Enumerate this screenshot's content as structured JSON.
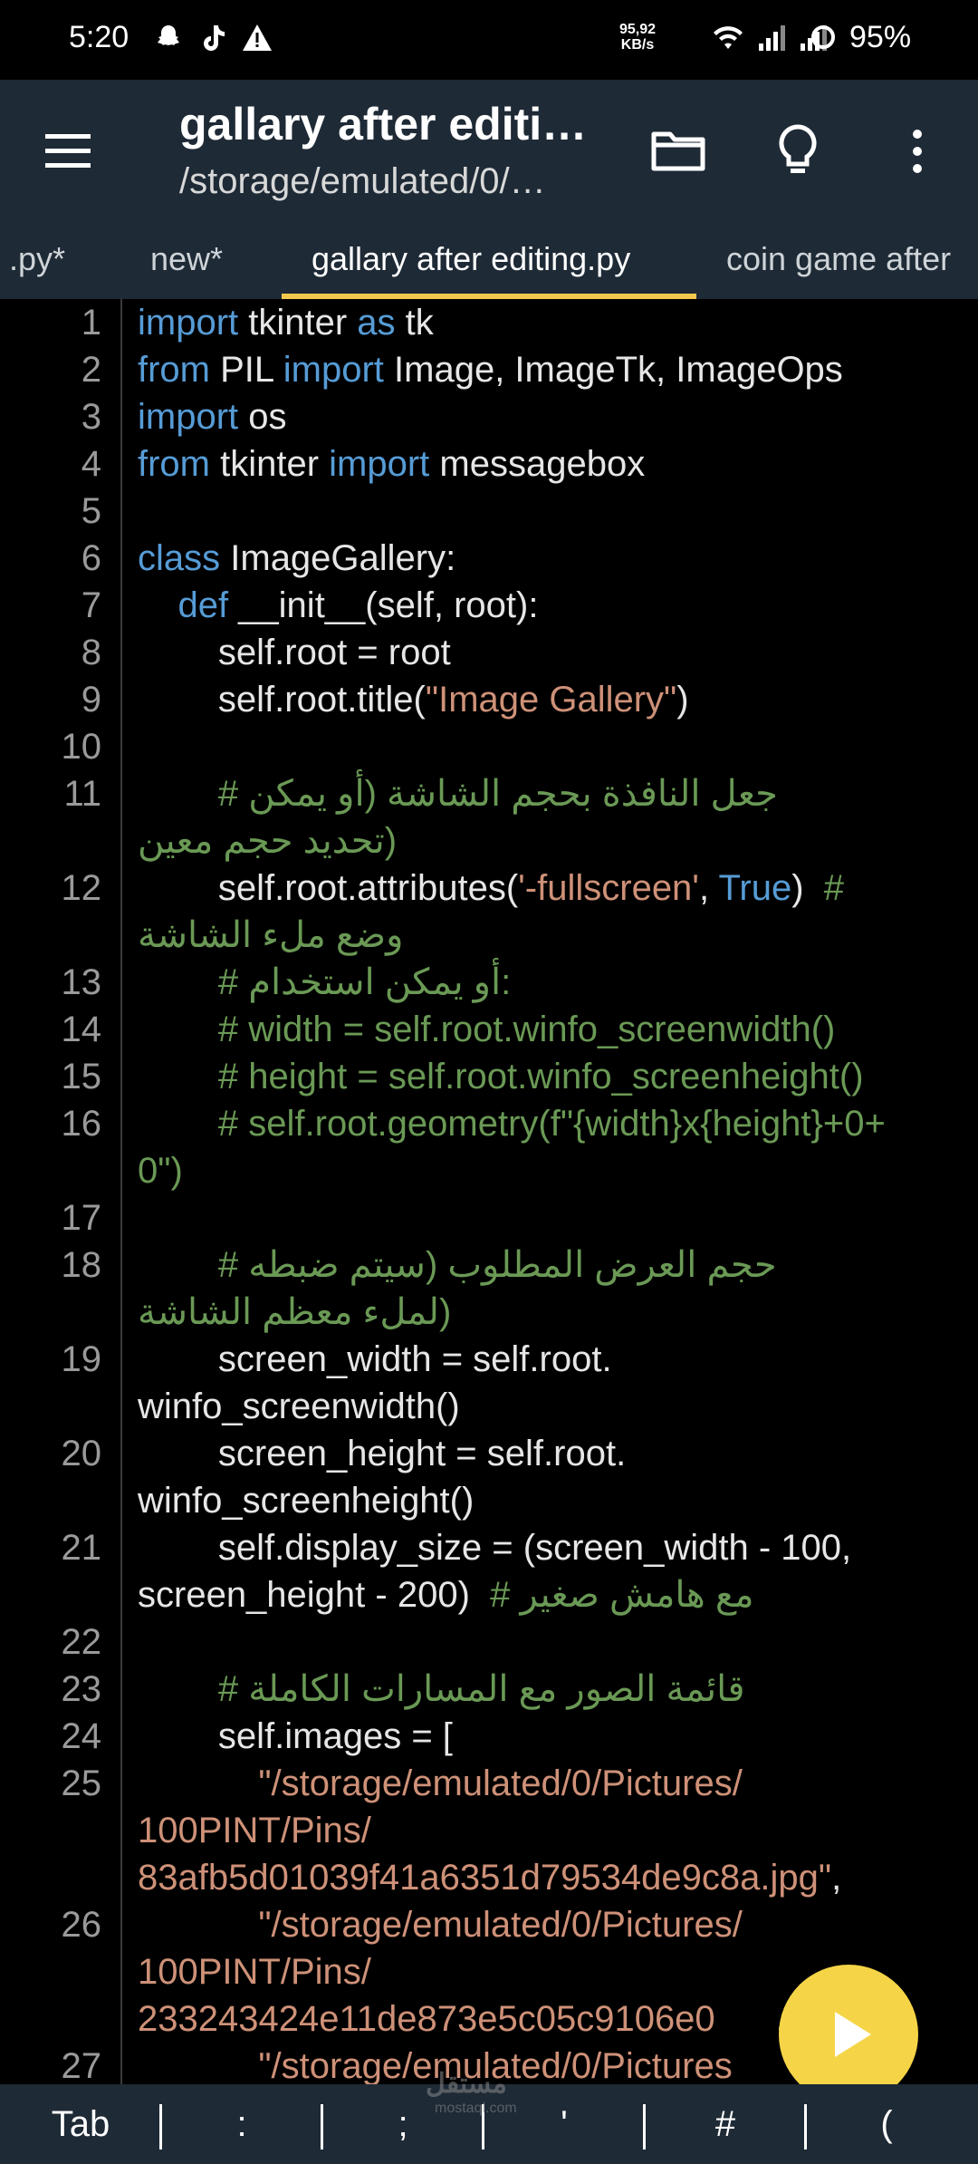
{
  "status_bar": {
    "time": "5:20",
    "speed_value": "95,92",
    "speed_unit": "KB/s",
    "battery": "95%"
  },
  "toolbar": {
    "title": "gallary after editi…",
    "path": "/storage/emulated/0/…"
  },
  "tabs": [
    {
      "label": ".py*"
    },
    {
      "label": "new*"
    },
    {
      "label": "gallary after editing.py"
    },
    {
      "label": "coin game after"
    }
  ],
  "code_lines": [
    {
      "ln": "1",
      "parts": [
        [
          "kw",
          "import"
        ],
        [
          "n",
          " tkinter "
        ],
        [
          "kw",
          "as"
        ],
        [
          "n",
          " tk"
        ]
      ]
    },
    {
      "ln": "2",
      "parts": [
        [
          "kw",
          "from"
        ],
        [
          "n",
          " PIL "
        ],
        [
          "kw",
          "import"
        ],
        [
          "n",
          " Image, ImageTk, ImageOps"
        ]
      ]
    },
    {
      "ln": "3",
      "parts": [
        [
          "kw",
          "import"
        ],
        [
          "n",
          " os"
        ]
      ]
    },
    {
      "ln": "4",
      "parts": [
        [
          "kw",
          "from"
        ],
        [
          "n",
          " tkinter "
        ],
        [
          "kw",
          "import"
        ],
        [
          "n",
          " messagebox"
        ]
      ]
    },
    {
      "ln": "5",
      "parts": []
    },
    {
      "ln": "6",
      "parts": [
        [
          "kw",
          "class"
        ],
        [
          "n",
          " ImageGallery:"
        ]
      ]
    },
    {
      "ln": "7",
      "parts": [
        [
          "n",
          "    "
        ],
        [
          "kw",
          "def"
        ],
        [
          "n",
          " __init__(self, root):"
        ]
      ]
    },
    {
      "ln": "8",
      "parts": [
        [
          "n",
          "        self.root = root"
        ]
      ]
    },
    {
      "ln": "9",
      "parts": [
        [
          "n",
          "        self.root.title("
        ],
        [
          "str",
          "\"Image Gallery\""
        ],
        [
          "n",
          ")"
        ]
      ]
    },
    {
      "ln": "10",
      "parts": []
    },
    {
      "ln": "11",
      "parts": [
        [
          "n",
          "        "
        ],
        [
          "com",
          "# جعل النافذة بحجم الشاشة (أو يمكن"
        ]
      ]
    },
    {
      "ln": "",
      "parts": [
        [
          "com",
          "تحديد حجم معين)"
        ]
      ]
    },
    {
      "ln": "12",
      "parts": [
        [
          "n",
          "        self.root.attributes("
        ],
        [
          "str",
          "'-fullscreen'"
        ],
        [
          "n",
          ", "
        ],
        [
          "kw",
          "True"
        ],
        [
          "n",
          ")  "
        ],
        [
          "com",
          "#"
        ]
      ]
    },
    {
      "ln": "",
      "parts": [
        [
          "com",
          "وضع ملء الشاشة"
        ]
      ]
    },
    {
      "ln": "13",
      "parts": [
        [
          "n",
          "        "
        ],
        [
          "com",
          "# أو يمكن استخدام:"
        ]
      ]
    },
    {
      "ln": "14",
      "parts": [
        [
          "n",
          "        "
        ],
        [
          "com",
          "# width = self.root.winfo_screenwidth()"
        ]
      ]
    },
    {
      "ln": "15",
      "parts": [
        [
          "n",
          "        "
        ],
        [
          "com",
          "# height = self.root.winfo_screenheight()"
        ]
      ]
    },
    {
      "ln": "16",
      "parts": [
        [
          "n",
          "        "
        ],
        [
          "com",
          "# self.root.geometry(f\"{width}x{height}+0+"
        ]
      ]
    },
    {
      "ln": "",
      "parts": [
        [
          "com",
          "0\")"
        ]
      ]
    },
    {
      "ln": "17",
      "parts": []
    },
    {
      "ln": "18",
      "parts": [
        [
          "n",
          "        "
        ],
        [
          "com",
          "# حجم العرض المطلوب (سيتم ضبطه"
        ]
      ]
    },
    {
      "ln": "",
      "parts": [
        [
          "com",
          "لملء معظم الشاشة)"
        ]
      ]
    },
    {
      "ln": "19",
      "parts": [
        [
          "n",
          "        screen_width = self.root."
        ]
      ]
    },
    {
      "ln": "",
      "parts": [
        [
          "n",
          "winfo_screenwidth()"
        ]
      ]
    },
    {
      "ln": "20",
      "parts": [
        [
          "n",
          "        screen_height = self.root."
        ]
      ]
    },
    {
      "ln": "",
      "parts": [
        [
          "n",
          "winfo_screenheight()"
        ]
      ]
    },
    {
      "ln": "21",
      "parts": [
        [
          "n",
          "        self.display_size = (screen_width - 100,"
        ]
      ]
    },
    {
      "ln": "",
      "parts": [
        [
          "n",
          "screen_height - 200)  "
        ],
        [
          "com",
          "# مع هامش صغير"
        ]
      ]
    },
    {
      "ln": "22",
      "parts": []
    },
    {
      "ln": "23",
      "parts": [
        [
          "n",
          "        "
        ],
        [
          "com",
          "# قائمة الصور مع المسارات الكاملة"
        ]
      ]
    },
    {
      "ln": "24",
      "parts": [
        [
          "n",
          "        self.images = ["
        ]
      ]
    },
    {
      "ln": "25",
      "parts": [
        [
          "n",
          "            "
        ],
        [
          "str",
          "\"/storage/emulated/0/Pictures/"
        ]
      ]
    },
    {
      "ln": "",
      "parts": [
        [
          "str",
          "100PINT/Pins/"
        ]
      ]
    },
    {
      "ln": "",
      "parts": [
        [
          "str",
          "83afb5d01039f41a6351d79534de9c8a.jpg\""
        ],
        [
          "n",
          ","
        ]
      ]
    },
    {
      "ln": "26",
      "parts": [
        [
          "n",
          "            "
        ],
        [
          "str",
          "\"/storage/emulated/0/Pictures/"
        ]
      ]
    },
    {
      "ln": "",
      "parts": [
        [
          "str",
          "100PINT/Pins/"
        ]
      ]
    },
    {
      "ln": "",
      "parts": [
        [
          "str",
          "233243424e11de873e5c05c9106e0"
        ],
        [
          "n",
          "      ,"
        ]
      ]
    },
    {
      "ln": "27",
      "parts": [
        [
          "n",
          "            "
        ],
        [
          "str",
          "\"/storage/emulated/0/Pictures"
        ]
      ]
    }
  ],
  "extra_keys": [
    "Tab",
    ":",
    ";",
    "'",
    "#",
    "("
  ],
  "watermark": "مستقل",
  "watermark_sub": "mostaql.com",
  "colors": {
    "toolbar_bg": "#1e2a36",
    "accent": "#f2c94c",
    "keyword": "#569cd6",
    "string": "#ce9178",
    "comment": "#6a9955",
    "fab": "#f5d547"
  }
}
